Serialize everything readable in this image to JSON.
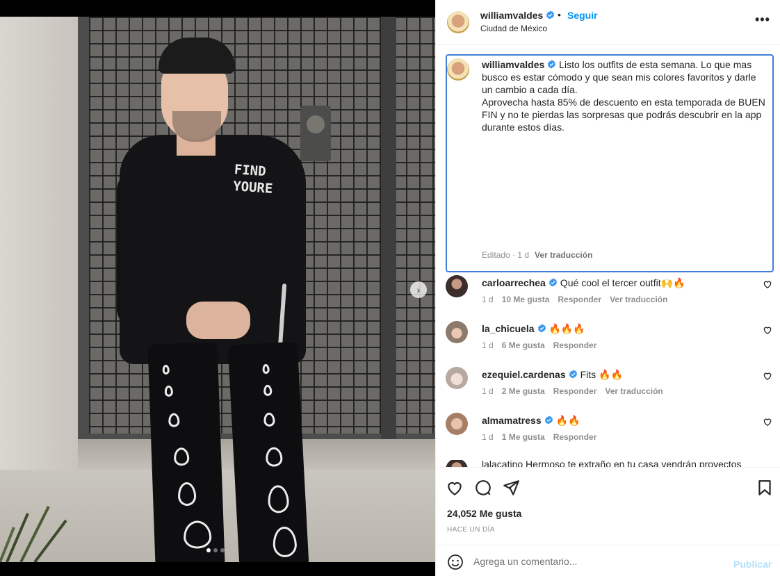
{
  "post": {
    "author": "williamvaldes",
    "follow_label": "Seguir",
    "bullet": "•",
    "location": "Ciudad de México",
    "more": "•••",
    "photo_print": "FIND\nYOURE"
  },
  "caption": {
    "username": "williamvaldes",
    "text": "Listo los outfits de esta semana. Lo que mas busco es estar cómodo y que sean mis colores favoritos y darle un cambio a cada día.\nAprovecha hasta 85% de descuento en esta temporada de BUEN FIN y no te pierdas las sorpresas que podrás descubrir en la app durante estos días.",
    "meta": "Editado · 1 d",
    "translate": "Ver traducción"
  },
  "comments": [
    {
      "username": "carloarrechea",
      "text": "Qué cool el tercer outfit🙌🔥",
      "age": "1 d",
      "likes": "10 Me gusta",
      "reply": "Responder",
      "translate": "Ver traducción"
    },
    {
      "username": "la_chicuela",
      "text": "🔥🔥🔥",
      "age": "1 d",
      "likes": "6 Me gusta",
      "reply": "Responder",
      "translate": ""
    },
    {
      "username": "ezequiel.cardenas",
      "text": "Fits 🔥🔥",
      "age": "1 d",
      "likes": "2 Me gusta",
      "reply": "Responder",
      "translate": "Ver traducción"
    },
    {
      "username": "almamatress",
      "text": "🔥🔥",
      "age": "1 d",
      "likes": "1 Me gusta",
      "reply": "Responder",
      "translate": ""
    }
  ],
  "partial_comment": "lalacatino Hermoso te extraño en tu casa vendrán proyectos",
  "stats": {
    "likes": "24,052 Me gusta",
    "posted": "HACE UN DÍA"
  },
  "composer": {
    "placeholder": "Agrega un comentario...",
    "post_label": "Publicar"
  },
  "carousel": {
    "next": "›"
  },
  "colors": {
    "accent": "#0095f6",
    "verified": "#3897f0",
    "focus": "#3f7fd6"
  }
}
